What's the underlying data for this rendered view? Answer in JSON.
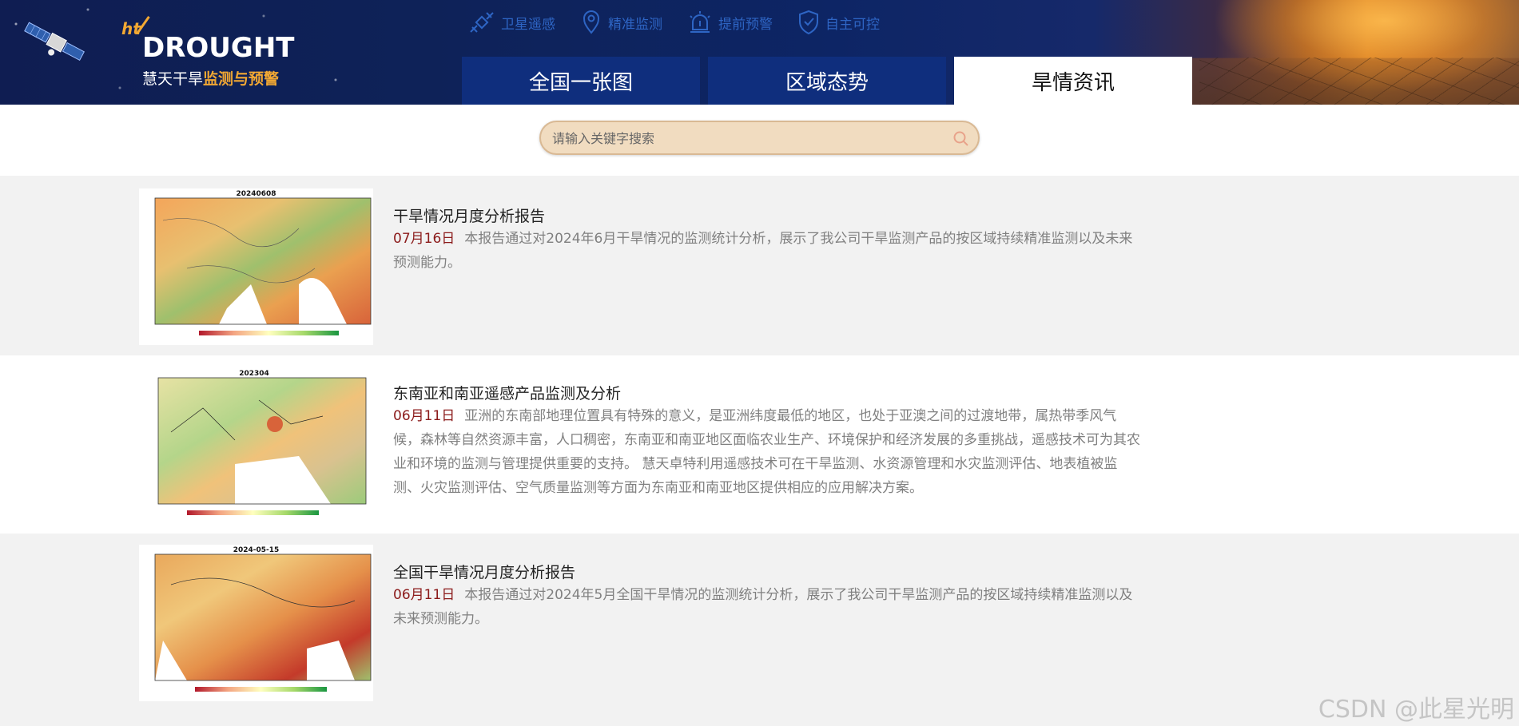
{
  "header": {
    "logo": {
      "ht": "ht",
      "main": "DROUGHT",
      "sub_white": "慧天干旱",
      "sub_accent": "监测与预警"
    },
    "topnav": [
      {
        "icon": "satellite-icon",
        "label": "卫星遥感"
      },
      {
        "icon": "location-pin-icon",
        "label": "精准监测"
      },
      {
        "icon": "alarm-icon",
        "label": "提前预警"
      },
      {
        "icon": "shield-icon",
        "label": "自主可控"
      }
    ],
    "tabs": [
      {
        "label": "全国一张图",
        "active": false
      },
      {
        "label": "区域态势",
        "active": false
      },
      {
        "label": "旱情资讯",
        "active": true
      }
    ]
  },
  "search": {
    "placeholder": "请输入关键字搜索",
    "value": ""
  },
  "news": [
    {
      "thumb_title": "20240608",
      "title": "干旱情况月度分析报告",
      "date": "07月16日",
      "desc": "本报告通过对2024年6月干旱情况的监测统计分析，展示了我公司干旱监测产品的按区域持续精准监测以及未来预测能力。"
    },
    {
      "thumb_title": "202304",
      "title": "东南亚和南亚遥感产品监测及分析",
      "date": "06月11日",
      "desc": "亚洲的东南部地理位置具有特殊的意义，是亚洲纬度最低的地区，也处于亚澳之间的过渡地带，属热带季风气候，森林等自然资源丰富，人口稠密，东南亚和南亚地区面临农业生产、环境保护和经济发展的多重挑战，遥感技术可为其农业和环境的监测与管理提供重要的支持。 慧天卓特利用遥感技术可在干旱监测、水资源管理和水灾监测评估、地表植被监测、火灾监测评估、空气质量监测等方面为东南亚和南亚地区提供相应的应用解决方案。"
    },
    {
      "thumb_title": "2024-05-15",
      "title": "全国干旱情况月度分析报告",
      "date": "06月11日",
      "desc": "本报告通过对2024年5月全国干旱情况的监测统计分析，展示了我公司干旱监测产品的按区域持续精准监测以及未来预测能力。"
    }
  ],
  "watermark": "CSDN @此星光明",
  "colors": {
    "tab_bg": "#0f2e7d",
    "date": "#8b1a1a",
    "accent": "#f2a833",
    "nav_text": "#2e65c4"
  }
}
